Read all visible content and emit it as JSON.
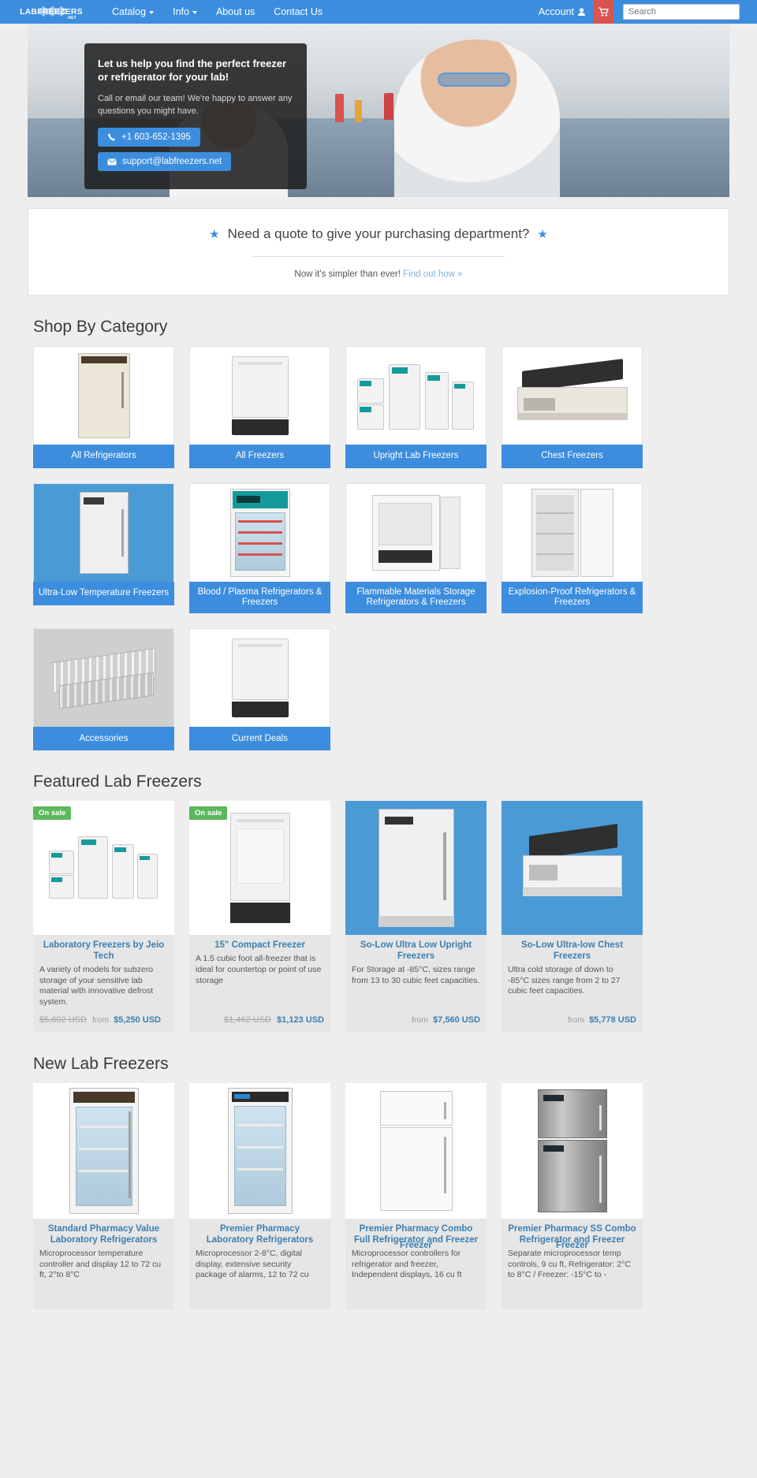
{
  "nav": {
    "brand": {
      "lab": "LAB",
      "freezers": "FREEZERS",
      "net": ".NET"
    },
    "links": [
      {
        "label": "Catalog",
        "caret": true
      },
      {
        "label": "Info",
        "caret": true
      },
      {
        "label": "About us",
        "caret": false
      },
      {
        "label": "Contact Us",
        "caret": false
      }
    ],
    "account_label": "Account",
    "account_icon": "user-icon",
    "cart_icon": "shopping-cart-icon",
    "search_placeholder": "Search"
  },
  "hero": {
    "heading": "Let us help you find the perfect freezer or refrigerator for your lab!",
    "paragraph": "Call or email our team! We're happy to answer any questions you might have.",
    "phone_label": "+1 603-652-1395",
    "phone_icon": "phone-icon",
    "email_label": "support@labfreezers.net",
    "email_icon": "envelope-icon"
  },
  "quote": {
    "star_icon": "star-icon",
    "heading": "Need a quote to give your purchasing department?",
    "sub_text": "Now it's simpler than ever!",
    "link_text": "Find out how »"
  },
  "sections": {
    "category_title": "Shop By Category",
    "featured_title": "Featured Lab Freezers",
    "new_title": "New Lab Freezers"
  },
  "categories": [
    {
      "label": "All Refrigerators",
      "art": "upright-cream"
    },
    {
      "label": "All Freezers",
      "art": "compact-white"
    },
    {
      "label": "Upright Lab Freezers",
      "art": "group-teal"
    },
    {
      "label": "Chest Freezers",
      "art": "chest-open"
    },
    {
      "label": "Ultra-Low Temperature Freezers",
      "art": "ult-blue"
    },
    {
      "label": "Blood / Plasma Refrigerators & Freezers",
      "art": "blood-teal"
    },
    {
      "label": "Flammable Materials Storage Refrigerators & Freezers",
      "art": "undercounter"
    },
    {
      "label": "Explosion-Proof Refrigerators & Freezers",
      "art": "open-door"
    },
    {
      "label": "Accessories",
      "art": "shelf-rack"
    },
    {
      "label": "Current Deals",
      "art": "compact-white"
    }
  ],
  "featured": [
    {
      "badge": "On sale",
      "art": "group-teal",
      "title": "Laboratory Freezers by Jeio Tech",
      "desc": "A variety of models for subzero storage of your sensitive lab material with innovative defrost system.",
      "price_old": "$5,602 USD",
      "price_from": "from",
      "price_now": "$5,250 USD",
      "price_align": "left"
    },
    {
      "badge": "On sale",
      "art": "compact-white",
      "title": "15\" Compact Freezer",
      "desc": "A 1.5 cubic foot all-freezer that is ideal for countertop or point of use storage",
      "price_old": "$1,462 USD",
      "price_from": "",
      "price_now": "$1,123 USD",
      "price_align": "right"
    },
    {
      "badge": "",
      "art": "ult-upright-blue",
      "title": "So-Low Ultra Low Upright Freezers",
      "desc": "For Storage at -85°C, sizes range from 13 to 30 cubic feet capacities.",
      "price_old": "",
      "price_from": "from",
      "price_now": "$7,560 USD",
      "price_align": "right"
    },
    {
      "badge": "",
      "art": "chest-blue",
      "title": "So-Low Ultra-low Chest Freezers",
      "desc": "Ultra cold storage of down to -85°C sizes range from 2 to 27 cubic feet capacities.",
      "price_old": "",
      "price_from": "from",
      "price_now": "$5,778 USD",
      "price_align": "right"
    }
  ],
  "new_products": [
    {
      "art": "glass-door",
      "title": "Standard Pharmacy Value Laboratory Refrigerators",
      "desc": "Microprocessor temperature controller and display 12 to 72 cu ft, 2°to 8°C"
    },
    {
      "art": "glass-door-premier",
      "title": "Premier Pharmacy Laboratory Refrigerators",
      "desc": "Microprocessor 2-8°C, digital display, extensive security package of alarms, 12 to 72 cu"
    },
    {
      "art": "combo-white",
      "title": "Premier Pharmacy Combo Full Refrigerator and Freezer",
      "title_overlap": "Freezer",
      "desc": "Microprocessor controllers for refrigerator and freezer, Independent displays, 16 cu ft"
    },
    {
      "art": "combo-steel",
      "title": "Premier Pharmacy SS Combo Refrigerator and Freezer",
      "title_overlap": "Freezer",
      "desc": "Separate microprocessor temp controls, 9 cu ft, Refrigerator: 2°C to 8°C / Freezer: -15°C to -"
    }
  ]
}
